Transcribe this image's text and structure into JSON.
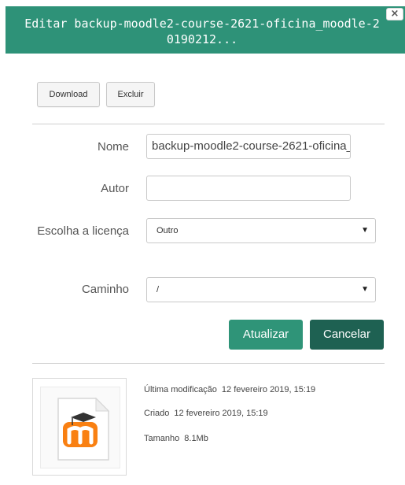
{
  "dialog": {
    "title": "Editar backup-moodle2-course-2621-oficina_moodle-20190212...",
    "close_label": "×"
  },
  "toolbar": {
    "download_label": "Download",
    "delete_label": "Excluir"
  },
  "form": {
    "name_label": "Nome",
    "name_value": "backup-moodle2-course-2621-oficina_moodle-20190212",
    "author_label": "Autor",
    "author_value": "",
    "license_label": "Escolha a licença",
    "license_value": "Outro",
    "path_label": "Caminho",
    "path_value": "/"
  },
  "actions": {
    "update_label": "Atualizar",
    "cancel_label": "Cancelar"
  },
  "file_info": {
    "modified_label": "Última modificação",
    "modified_value": "12 fevereiro 2019, 15:19",
    "created_label": "Criado",
    "created_value": "12 fevereiro 2019, 15:19",
    "size_label": "Tamanho",
    "size_value": "8.1Mb"
  },
  "colors": {
    "header": "#2e9278",
    "primary_button": "#2f9478",
    "secondary_button": "#1e6152",
    "moodle_orange": "#f98012"
  },
  "icons": {
    "close": "close-icon",
    "dropdown": "caret-down-icon",
    "file": "moodle-file-icon"
  }
}
